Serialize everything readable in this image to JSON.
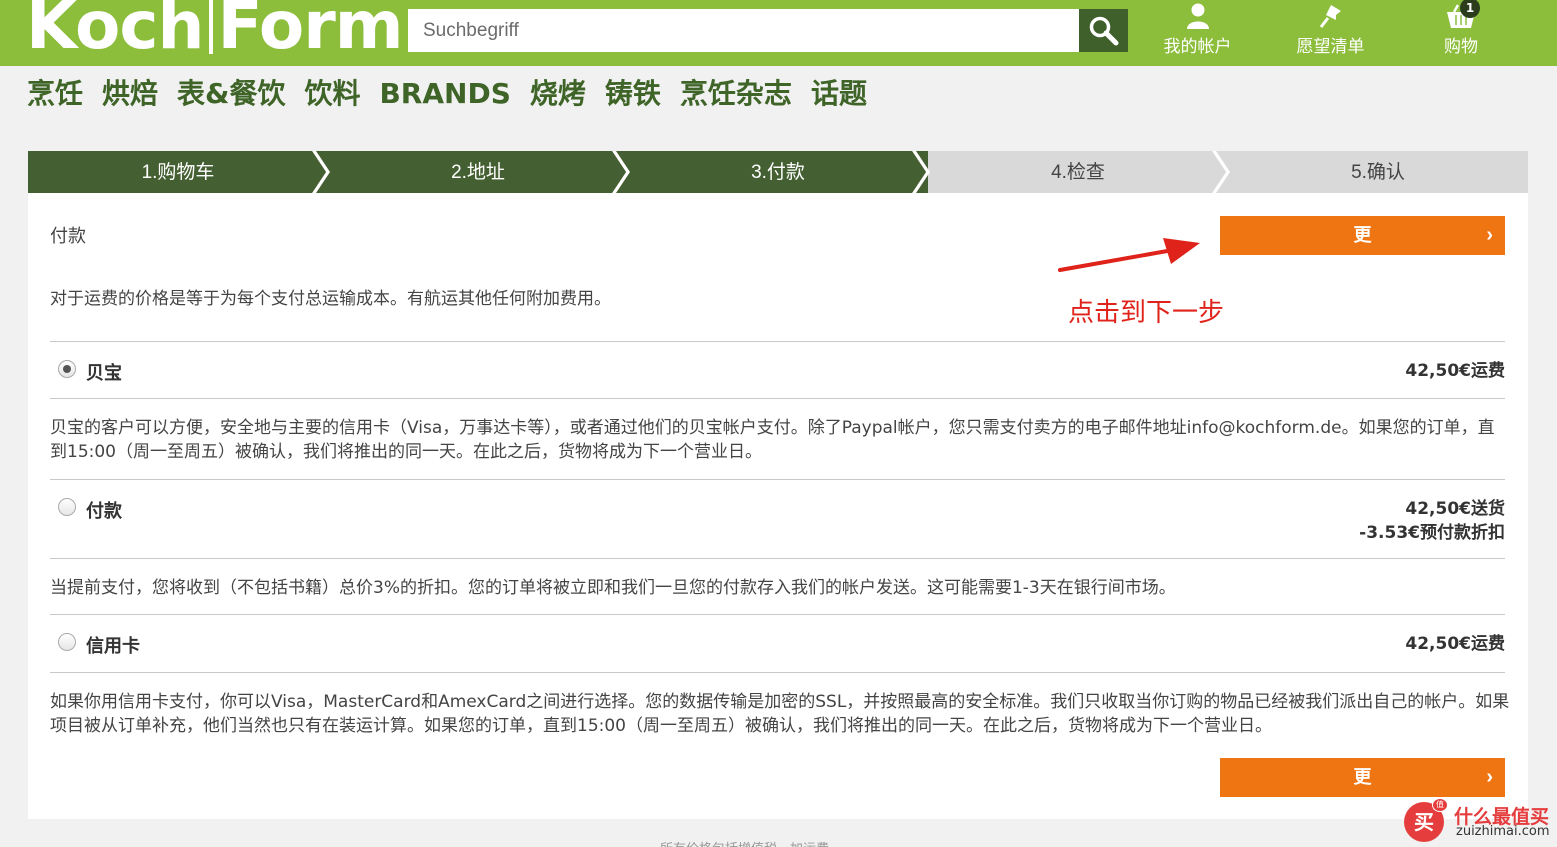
{
  "header": {
    "logo": {
      "left": "Koch",
      "right": "Form"
    },
    "search": {
      "placeholder": "Suchbegriff",
      "button_icon": "search-icon"
    },
    "account": {
      "label": "我的帐户",
      "icon": "user-icon"
    },
    "wishlist": {
      "label": "愿望清单",
      "icon": "pin-icon"
    },
    "cart": {
      "label": "购物",
      "icon": "basket-icon",
      "count": "1"
    }
  },
  "nav": {
    "items": [
      "烹饪",
      "烘焙",
      "表&餐饮",
      "饮料",
      "BRANDS",
      "烧烤",
      "铸铁",
      "烹饪杂志",
      "话题"
    ]
  },
  "steps": {
    "items": [
      {
        "label": "1.购物车",
        "state": "active"
      },
      {
        "label": "2.地址",
        "state": "active"
      },
      {
        "label": "3.付款",
        "state": "active"
      },
      {
        "label": "4.检查",
        "state": "inactive"
      },
      {
        "label": "5.确认",
        "state": "inactive"
      }
    ]
  },
  "main": {
    "section_label": "付款",
    "intro": "对于运费的价格是等于为每个支付总运输成本。有航运其他任何附加费用。",
    "next_button": "更",
    "next_button_arrow": "›",
    "annotation": "点击到下一步",
    "options": [
      {
        "name": "贝宝",
        "checked": true,
        "price_lines": [
          "42,50€运费"
        ],
        "description": "贝宝的客户可以方便，安全地与主要的信用卡（Visa，万事达卡等），或者通过他们的贝宝帐户支付。除了Paypal帐户，您只需支付卖方的电子邮件地址info@kochform.de。如果您的订单，直到15:00（周一至周五）被确认，我们将推出的同一天。在此之后，货物将成为下一个营业日。"
      },
      {
        "name": "付款",
        "checked": false,
        "price_lines": [
          "42,50€送货",
          "-3.53€预付款折扣"
        ],
        "description": "当提前支付，您将收到（不包括书籍）总价3%的折扣。您的订单将被立即和我们一旦您的付款存入我们的帐户发送。这可能需要1-3天在银行间市场。"
      },
      {
        "name": "信用卡",
        "checked": false,
        "price_lines": [
          "42,50€运费"
        ],
        "description": "如果你用信用卡支付，你可以Visa，MasterCard和AmexCard之间进行选择。您的数据传输是加密的SSL，并按照最高的安全标准。我们只收取当你订购的物品已经被我们派出自己的帐户。如果项目被从订单补充，他们当然也只有在装运计算。如果您的订单，直到15:00（周一至周五）被确认，我们将推出的同一天。在此之后，货物将成为下一个营业日。"
      }
    ]
  },
  "footer": {
    "faint_text": "所有价格包括增值税，加运费"
  },
  "watermark": {
    "glyph": "买",
    "badge": "值",
    "title": "什么最值买",
    "domain": "zuizhimai.com"
  },
  "colors": {
    "header_green": "#8cbe3c",
    "nav_green": "#3f6427",
    "step_active": "#445f31",
    "step_inactive": "#d9d9d9",
    "accent_orange": "#ef7412",
    "annotation_red": "#e0231a"
  }
}
